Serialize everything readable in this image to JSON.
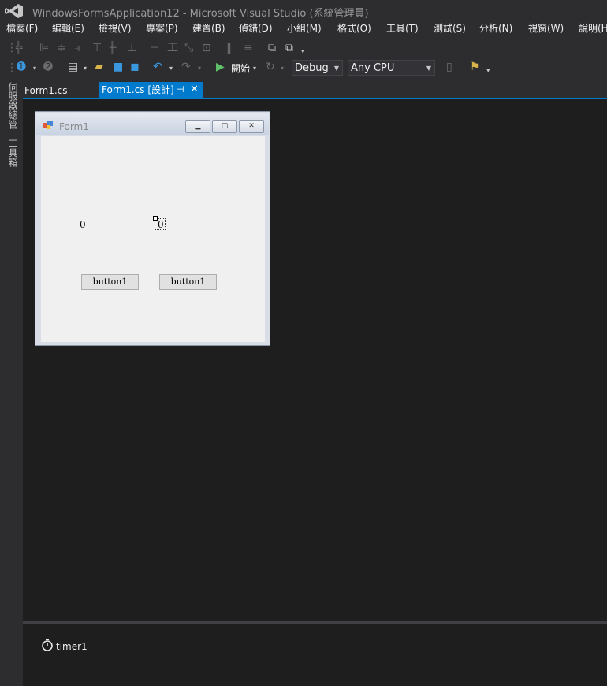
{
  "window": {
    "title": "WindowsFormsApplication12 - Microsoft Visual Studio (系統管理員)"
  },
  "menu": {
    "items": [
      "檔案(F)",
      "編輯(E)",
      "檢視(V)",
      "專案(P)",
      "建置(B)",
      "偵錯(D)",
      "小組(M)",
      "格式(O)",
      "工具(T)",
      "測試(S)",
      "分析(N)",
      "視窗(W)",
      "說明(H)"
    ]
  },
  "toolbar": {
    "start_label": "開始",
    "configuration": "Debug",
    "platform": "Any CPU"
  },
  "side_panels": {
    "server_explorer": "伺服器總管",
    "toolbox": "工具箱"
  },
  "tabs": {
    "code_tab": "Form1.cs",
    "designer_tab": "Form1.cs [設計]"
  },
  "form": {
    "title": "Form1",
    "label1_text": "0",
    "label2_text": "0",
    "button1_text": "button1",
    "button2_text": "button1"
  },
  "component_tray": {
    "timer_name": "timer1"
  },
  "colors": {
    "accent": "#007acc",
    "background": "#2d2d30",
    "editor": "#1e1e1e"
  }
}
